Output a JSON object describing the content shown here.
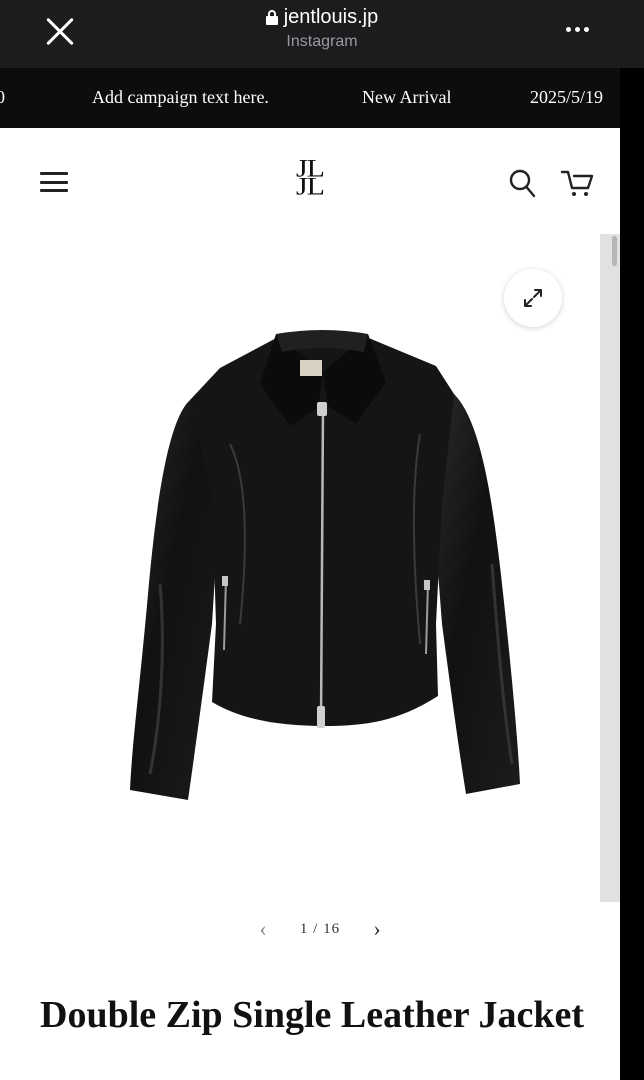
{
  "browser": {
    "domain": "jentlouis.jp",
    "app_name": "Instagram"
  },
  "campaign_bar": {
    "items": [
      "0",
      "Add campaign text here.",
      "New Arrival",
      "2025/5/19"
    ]
  },
  "header": {
    "logo_line1": "JL",
    "logo_line2": "JL"
  },
  "gallery": {
    "current": 1,
    "total": 16,
    "pager_text": "1 / 16",
    "prev_arrow": "‹",
    "next_arrow": "›"
  },
  "product": {
    "title": "Double Zip Single Leather Jacket"
  },
  "colors": {
    "browser_bar": "#1c1c1e",
    "campaign_bar": "#0d0d0d",
    "page_bg": "#ffffff",
    "text": "#111111"
  }
}
